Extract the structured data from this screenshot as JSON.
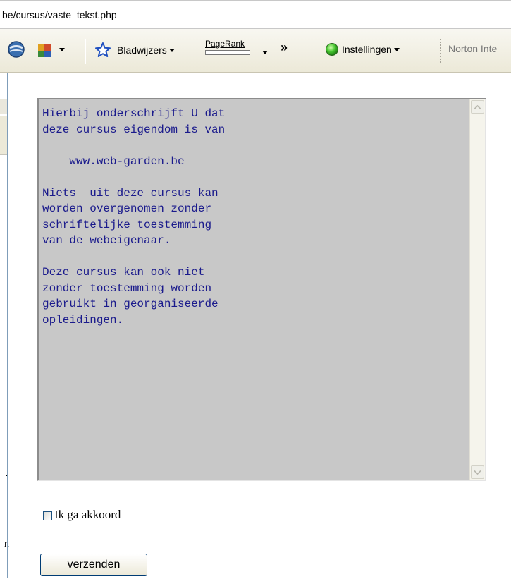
{
  "address_bar": {
    "url": "be/cursus/vaste_tekst.php"
  },
  "toolbar": {
    "globe_icon": "globe-icon",
    "puzzle_icon": "puzzle-icon",
    "bookmarks_label": "Bladwijzers",
    "pagerank_label": "PageRank",
    "more_glyph": "»",
    "settings_label": "Instellingen",
    "norton_label": "Norton Inte"
  },
  "form": {
    "textarea_text": "Hierbij onderschrijft U dat\ndeze cursus eigendom is van\n\n    www.web-garden.be\n\nNiets  uit deze cursus kan\nworden overgenomen zonder\nschriftelijke toestemming\nvan de webeigenaar.\n\nDeze cursus kan ook niet\nzonder toestemming worden\ngebruikt in georganiseerde\nopleidingen.",
    "checkbox_label": "Ik ga akkoord",
    "checkbox_checked": false,
    "submit_label": "verzenden"
  },
  "colors": {
    "textarea_bg": "#c8c8c8",
    "textarea_text": "#1a1a8c",
    "toolbar_bg": "#ece9d8"
  }
}
